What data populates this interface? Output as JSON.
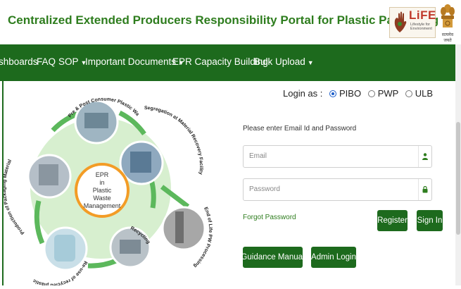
{
  "header": {
    "title": "Centralized Extended Producers Responsibility Portal for Plastic Packaging",
    "life_logo": {
      "word": "LiFE",
      "tagline": "Lifestyle for Environment"
    },
    "emblem": {
      "motto": "सत्यमेव जयते"
    }
  },
  "nav": {
    "items": [
      {
        "label": "shboards"
      },
      {
        "label": "FAQ"
      },
      {
        "label": "SOP",
        "dropdown": true
      },
      {
        "label": "Important Documents",
        "dropdown": true
      },
      {
        "label": "EPR Capacity Building"
      },
      {
        "label": "Bulk Upload",
        "dropdown": true
      }
    ]
  },
  "diagram": {
    "center": [
      "EPR",
      "in",
      "Plastic",
      "Waste",
      "Management"
    ],
    "stages": [
      "Pre & Post Consumer Plastic Waste",
      "Segregation at Material Recovery Facility",
      "End of Life PW Processing",
      "Recycling",
      "Re-use of recycled plastic",
      "Production of Packaging Material"
    ]
  },
  "login": {
    "login_as_label": "Login as :",
    "options": [
      "PIBO",
      "PWP",
      "ULB"
    ],
    "selected": "PIBO",
    "prompt": "Please enter Email Id and Password",
    "email_placeholder": "Email",
    "password_placeholder": "Password",
    "forgot_label": "Forgot Password",
    "register_label": "Register",
    "signin_label": "Sign In",
    "guidance_label": "Guidance Manual",
    "admin_label": "Admin Login"
  },
  "colors": {
    "brand_green": "#1d6a1d",
    "title_green": "#2e7d1e",
    "circle_fill": "#d7efcf"
  }
}
